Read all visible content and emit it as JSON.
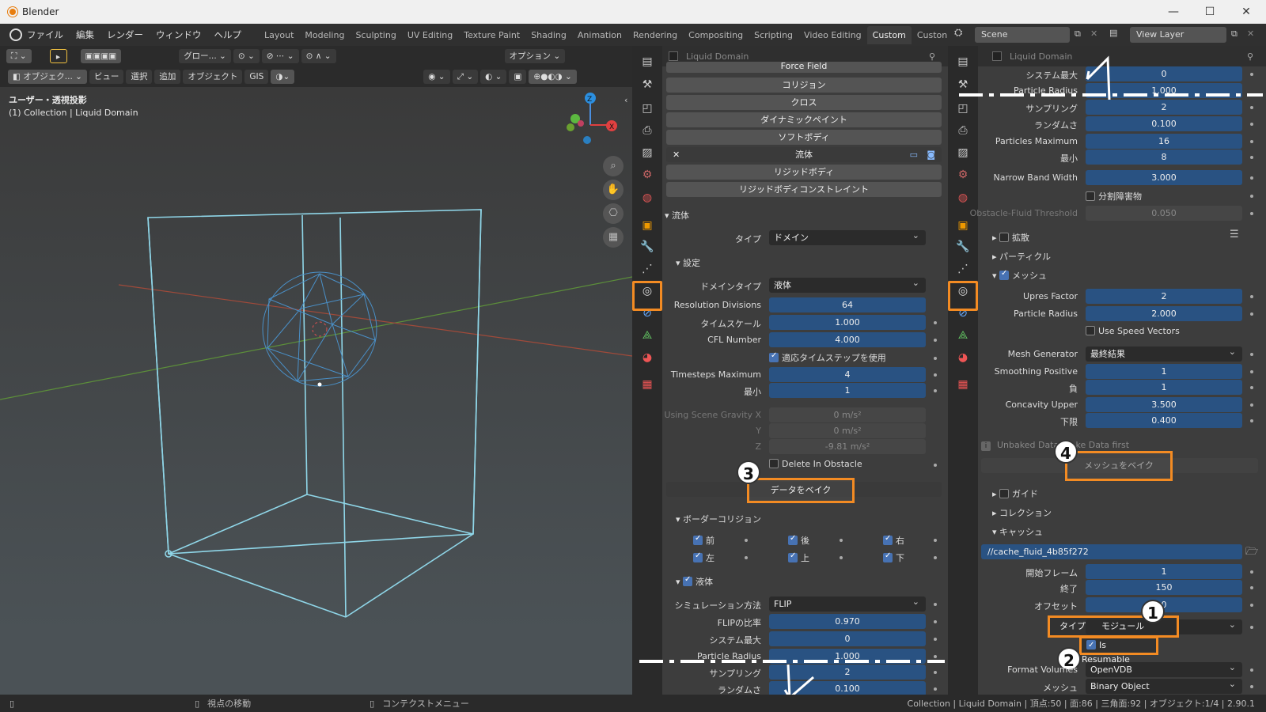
{
  "window": {
    "title": "Blender"
  },
  "menu": [
    "ファイル",
    "編集",
    "レンダー",
    "ウィンドウ",
    "ヘルプ"
  ],
  "workspaces": [
    "Layout",
    "Modeling",
    "Sculpting",
    "UV Editing",
    "Texture Paint",
    "Shading",
    "Animation",
    "Rendering",
    "Compositing",
    "Scripting",
    "Video Editing",
    "Custom",
    "Custon"
  ],
  "active_workspace": "Custom",
  "scene": "Scene",
  "view_layer": "View Layer",
  "viewport": {
    "transform": "グロー...",
    "options": "オプション",
    "mode": "オブジェク...",
    "menus": [
      "ビュー",
      "選択",
      "追加",
      "オブジェクト",
      "GIS"
    ],
    "view_name": "ユーザー・透視投影",
    "collection": "(1) Collection | Liquid Domain"
  },
  "left_panel": {
    "object": "Liquid Domain",
    "physics_buttons": [
      "Force Field",
      "コリジョン",
      "クロス",
      "ダイナミックペイント",
      "ソフトボディ",
      "流体",
      "リジッドボディ",
      "リジッドボディコンストレイント"
    ],
    "fluid_section": "流体",
    "type_label": "タイプ",
    "type_value": "ドメイン",
    "settings_section": "設定",
    "rows": [
      {
        "label": "ドメインタイプ",
        "value": "液体"
      },
      {
        "label": "Resolution Divisions",
        "value": "64"
      },
      {
        "label": "タイムスケール",
        "value": "1.000"
      },
      {
        "label": "CFL Number",
        "value": "4.000"
      },
      {
        "label": "Timesteps Maximum",
        "value": "4"
      },
      {
        "label": "最小",
        "value": "1"
      }
    ],
    "adaptive_timestep": "適応タイムステップを使用",
    "gravity": [
      {
        "label": "Using Scene Gravity X",
        "value": "0 m/s²"
      },
      {
        "label": "Y",
        "value": "0 m/s²"
      },
      {
        "label": "Z",
        "value": "-9.81 m/s²"
      }
    ],
    "delete_obstacle": "Delete In Obstacle",
    "bake_data": "データをベイク",
    "border_section": "ボーダーコリジョン",
    "borders": [
      "前",
      "後",
      "右",
      "左",
      "上",
      "下"
    ],
    "liquid_section": "液体",
    "liquid_rows": [
      {
        "label": "シミュレーション方法",
        "value": "FLIP"
      },
      {
        "label": "FLIPの比率",
        "value": "0.970"
      },
      {
        "label": "システム最大",
        "value": "0"
      },
      {
        "label": "Particle Radius",
        "value": "1.000"
      },
      {
        "label": "サンプリング",
        "value": "2"
      },
      {
        "label": "ランダムさ",
        "value": "0.100"
      }
    ]
  },
  "right_panel": {
    "object": "Liquid Domain",
    "rows_top": [
      {
        "label": "システム最大",
        "value": "0"
      },
      {
        "label": "Particle Radius",
        "value": "1.000"
      },
      {
        "label": "サンプリング",
        "value": "2"
      },
      {
        "label": "ランダムさ",
        "value": "0.100"
      },
      {
        "label": "Particles Maximum",
        "value": "16"
      },
      {
        "label": "最小",
        "value": "8"
      },
      {
        "label": "Narrow Band Width",
        "value": "3.000"
      }
    ],
    "fractional_obstacles": "分割障害物",
    "obstacle_threshold": {
      "label": "Obstacle-Fluid Threshold",
      "value": "0.050"
    },
    "diffusion": "拡散",
    "particles": "パーティクル",
    "mesh": "メッシュ",
    "mesh_rows": [
      {
        "label": "Upres Factor",
        "value": "2"
      },
      {
        "label": "Particle Radius",
        "value": "2.000"
      }
    ],
    "use_speed_vectors": "Use Speed Vectors",
    "mesh_generator": {
      "label": "Mesh Generator",
      "value": "最終結果"
    },
    "mesh_rows2": [
      {
        "label": "Smoothing Positive",
        "value": "1"
      },
      {
        "label": "負",
        "value": "1"
      },
      {
        "label": "Concavity Upper",
        "value": "3.500"
      },
      {
        "label": "下限",
        "value": "0.400"
      }
    ],
    "unbaked_msg": "Unbaked Data, Bake Data first",
    "bake_mesh": "メッシュをベイク",
    "guides": "ガイド",
    "collections": "コレクション",
    "cache": "キャッシュ",
    "cache_path": "//cache_fluid_4b85f272",
    "cache_rows": [
      {
        "label": "開始フレーム",
        "value": "1"
      },
      {
        "label": "終了",
        "value": "150"
      },
      {
        "label": "オフセット",
        "value": "0"
      }
    ],
    "cache_type": {
      "label": "タイプ",
      "value": "モジュール"
    },
    "is_resumable": "Is Resumable",
    "format_volume": {
      "label": "Format Volumes",
      "value": "OpenVDB"
    },
    "format_mesh": {
      "label": "メッシュ",
      "value": "Binary Object"
    }
  },
  "annotations": [
    "1",
    "2",
    "3",
    "4"
  ],
  "status": {
    "left1": "視点の移動",
    "left2": "コンテクストメニュー",
    "right": "Collection | Liquid Domain | 頂点:50 | 面:86 | 三角面:92 | オブジェクト:1/4 | 2.90.1"
  },
  "colors": {
    "accent": "#f38b23",
    "field_blue": "#295282",
    "wire": "#8fd6e8",
    "check": "#4772b3"
  }
}
